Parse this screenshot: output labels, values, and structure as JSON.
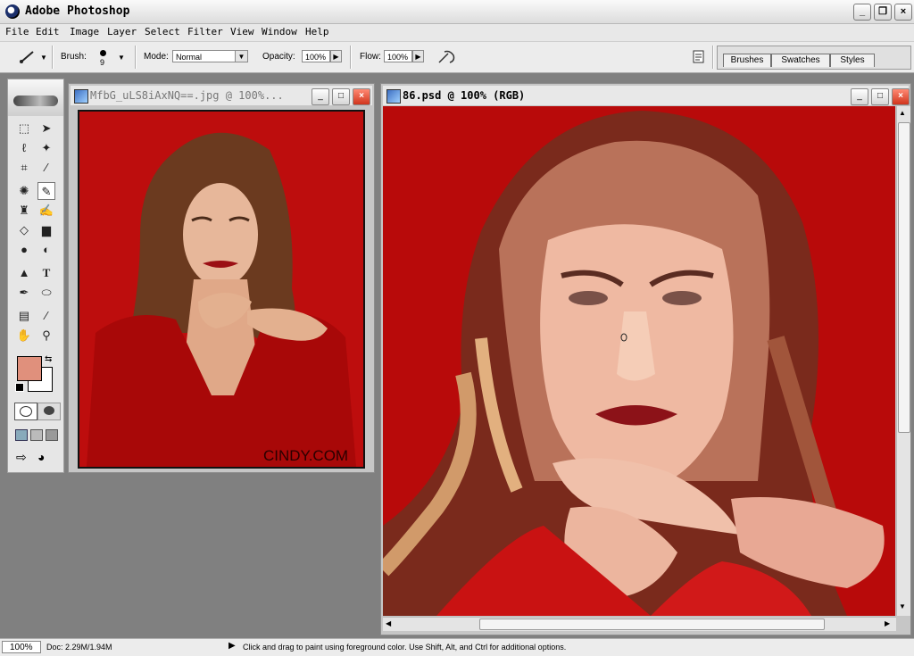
{
  "app": {
    "title": "Adobe Photoshop"
  },
  "window_buttons": {
    "minimize": "_",
    "maximize": "❐",
    "close": "×"
  },
  "menu": [
    "File",
    "Edit",
    "Image",
    "Layer",
    "Select",
    "Filter",
    "View",
    "Window",
    "Help"
  ],
  "options": {
    "brush_label": "Brush:",
    "brush_size": "9",
    "mode_label": "Mode:",
    "mode_value": "Normal",
    "opacity_label": "Opacity:",
    "opacity_value": "100%",
    "flow_label": "Flow:",
    "flow_value": "100%"
  },
  "palette_well": {
    "tabs": [
      "Brushes",
      "Swatches",
      "Styles"
    ]
  },
  "toolbox": {
    "foreground_color": "#e0907c",
    "background_color": "#ffffff"
  },
  "documents": [
    {
      "title": "MfbG_uLS8iAxNQ==.jpg @ 100%...",
      "watermark": "CINDY.COM"
    },
    {
      "title": "86.psd @ 100% (RGB)"
    }
  ],
  "status": {
    "zoom": "100%",
    "doc_size": "Doc: 2.29M/1.94M",
    "hint": "Click and drag to paint using foreground color.  Use Shift, Alt, and Ctrl for additional options."
  },
  "colors": {
    "canvas_red": "#b80a0a",
    "workspace": "#808080"
  }
}
